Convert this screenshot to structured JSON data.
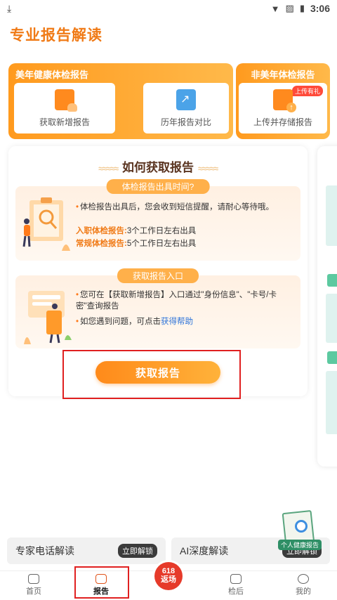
{
  "status_bar": {
    "time": "3:06"
  },
  "page": {
    "title": "专业报告解读"
  },
  "banner": {
    "left_title": "美年健康体检报告",
    "right_title": "非美年体检报告",
    "items": [
      {
        "label": "获取新增报告",
        "icon": "report-doc-icon"
      },
      {
        "label": "历年报告对比",
        "icon": "chart-icon"
      },
      {
        "label": "上传并存储报告",
        "icon": "upload-report-icon",
        "tag": "上传有礼"
      }
    ]
  },
  "how_to": {
    "heading": "如何获取报告",
    "section1": {
      "tag": "体检报告出具时间?",
      "desc": "体检报告出具后，您会收到短信提醒，请耐心等待哦。",
      "line1_label": "入职体检报告:",
      "line1_value": "3个工作日左右出具",
      "line2_label": "常规体检报告:",
      "line2_value": "5个工作日左右出具"
    },
    "section2": {
      "tag": "获取报告入口",
      "line1": "您可在【获取新增报告】入口通过\"身份信息\"、\"卡号/卡密\"查询报告",
      "line2_prefix": "如您遇到问题，可点击",
      "line2_link": "获得帮助"
    },
    "button": "获取报告"
  },
  "bottom_cards": [
    {
      "label": "专家电话解读",
      "action": "立即解锁"
    },
    {
      "label": "AI深度解读",
      "action": "立即解锁"
    }
  ],
  "float_badge": {
    "label": "个人健康报告"
  },
  "tabbar": {
    "tabs": [
      {
        "label": "首页"
      },
      {
        "label": "报告"
      },
      {
        "label": "检后"
      },
      {
        "label": "我的"
      }
    ],
    "promo": {
      "line1": "618",
      "line2": "返场"
    }
  },
  "colors": {
    "accent": "#f07a16",
    "highlight": "#e02020",
    "link": "#2e74d9"
  }
}
